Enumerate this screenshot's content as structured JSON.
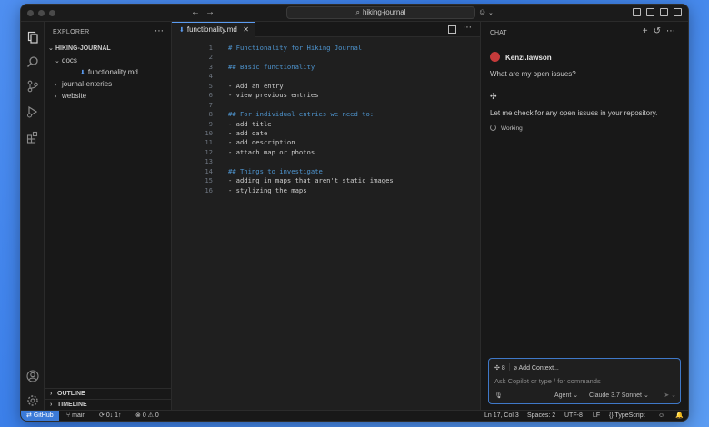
{
  "titlebar": {
    "search_text": "hiking-journal",
    "back_icon": "arrow-left-icon",
    "forward_icon": "arrow-right-icon"
  },
  "activitybar": {
    "items": [
      "explorer-icon",
      "search-icon",
      "source-control-icon",
      "run-debug-icon",
      "extensions-icon"
    ],
    "bottom": [
      "account-icon",
      "settings-icon"
    ]
  },
  "sidebar": {
    "header": "EXPLORER",
    "root": "HIKING-JOURNAL",
    "tree": [
      {
        "label": "docs",
        "expanded": true
      },
      {
        "label": "functionality.md"
      },
      {
        "label": "journal-enteries",
        "expanded": false
      },
      {
        "label": "website",
        "expanded": false
      }
    ],
    "outline": "OUTLINE",
    "timeline": "TIMELINE"
  },
  "editor": {
    "tab_label": "functionality.md",
    "lines": [
      {
        "n": "1",
        "text": "# Functionality for Hiking Journal",
        "kind": "heading"
      },
      {
        "n": "2",
        "text": "",
        "kind": "text"
      },
      {
        "n": "3",
        "text": "## Basic functionality",
        "kind": "heading"
      },
      {
        "n": "4",
        "text": "",
        "kind": "text"
      },
      {
        "n": "5",
        "text": "- Add an entry",
        "kind": "text"
      },
      {
        "n": "6",
        "text": "- view previous entries",
        "kind": "text"
      },
      {
        "n": "7",
        "text": "",
        "kind": "text"
      },
      {
        "n": "8",
        "text": "## For individual entries we need to:",
        "kind": "heading"
      },
      {
        "n": "9",
        "text": "- add title",
        "kind": "text"
      },
      {
        "n": "10",
        "text": "- add date",
        "kind": "text"
      },
      {
        "n": "11",
        "text": "- add description",
        "kind": "text"
      },
      {
        "n": "12",
        "text": "- attach map or photos",
        "kind": "text"
      },
      {
        "n": "13",
        "text": "",
        "kind": "text"
      },
      {
        "n": "14",
        "text": "## Things to investigate",
        "kind": "heading"
      },
      {
        "n": "15",
        "text": "- adding in maps that aren't static images",
        "kind": "text"
      },
      {
        "n": "16",
        "text": "- stylizing the maps",
        "kind": "text"
      }
    ]
  },
  "chat": {
    "title": "CHAT",
    "username": "Kenzi.lawson",
    "question": "What are my open issues?",
    "reply": "Let me check for any open issues in your repository.",
    "status": "Working",
    "input": {
      "tools_count": "8",
      "add_context": "Add Context...",
      "placeholder": "Ask Copilot or type / for commands",
      "mode": "Agent",
      "model": "Claude 3.7 Sonnet"
    }
  },
  "statusbar": {
    "remote": "GitHub",
    "branch": "main",
    "sync": "0↓ 1↑",
    "problems": "0",
    "warnings": "0",
    "cursor": "Ln 17, Col 3",
    "spaces": "Spaces: 2",
    "encoding": "UTF-8",
    "eol": "LF",
    "language": "TypeScript"
  }
}
